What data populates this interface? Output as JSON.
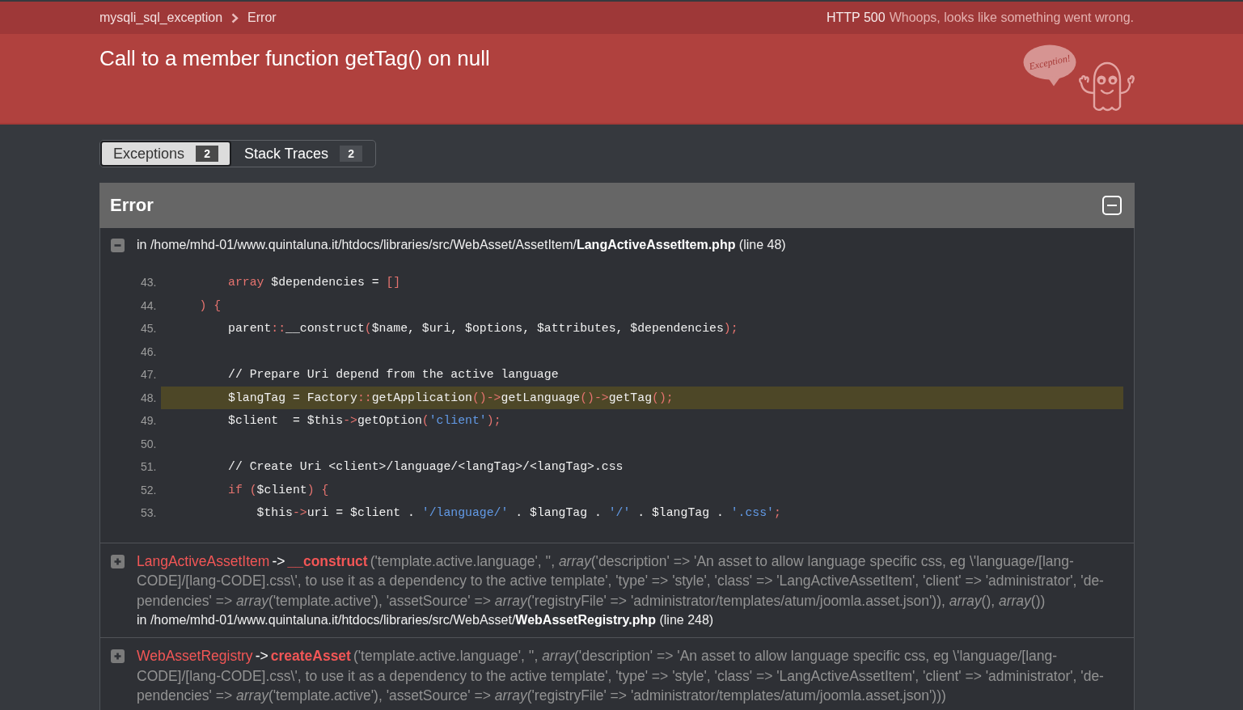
{
  "breadcrumb": {
    "items": [
      "mysqli_sql_exception",
      "Error"
    ],
    "status_code": "HTTP 500",
    "status_message": "Whoops, looks like something went wrong."
  },
  "header": {
    "title": "Call to a member function getTag() on null",
    "logo_text": "Exception!"
  },
  "tabs": [
    {
      "label": "Exceptions",
      "count": "2",
      "selected": true
    },
    {
      "label": "Stack Traces",
      "count": "2",
      "selected": false
    }
  ],
  "exception": {
    "title": "Error",
    "expanded": true,
    "frames": [
      {
        "kind": "source",
        "expanded": true,
        "location": "in /home/mhd-01/www.quintaluna.it/htdocs/libraries/src/WebAsset/AssetItem/**LangActiveAssetItem.php** (line 48)",
        "code": [
          {
            "number": "43.",
            "highlighted": false,
            "tokens": [
              {
                "kind": "keyword",
                "text": "        array"
              },
              {
                "kind": "plain",
                "text": " $dependencies = "
              },
              {
                "kind": "operator",
                "text": "[]"
              }
            ]
          },
          {
            "number": "44.",
            "highlighted": false,
            "tokens": [
              {
                "kind": "operator",
                "text": "    ) {"
              }
            ]
          },
          {
            "number": "45.",
            "highlighted": false,
            "tokens": [
              {
                "kind": "plain",
                "text": "        parent"
              },
              {
                "kind": "operator",
                "text": "::"
              },
              {
                "kind": "plain",
                "text": "__construct"
              },
              {
                "kind": "operator",
                "text": "("
              },
              {
                "kind": "plain",
                "text": "$name, $uri, $options, $attributes, $dependencies"
              },
              {
                "kind": "operator",
                "text": ");"
              }
            ]
          },
          {
            "number": "46.",
            "highlighted": false
          },
          {
            "number": "47.",
            "highlighted": false,
            "tokens": [
              {
                "kind": "comment",
                "text": "        // Prepare Uri depend from the active language"
              }
            ]
          },
          {
            "number": "48.",
            "highlighted": true,
            "tokens": [
              {
                "kind": "plain",
                "text": "        $langTag = Factory"
              },
              {
                "kind": "operator",
                "text": "::"
              },
              {
                "kind": "plain",
                "text": "getApplication"
              },
              {
                "kind": "operator",
                "text": "()->"
              },
              {
                "kind": "plain",
                "text": "getLanguage"
              },
              {
                "kind": "operator",
                "text": "()->"
              },
              {
                "kind": "plain",
                "text": "getTag"
              },
              {
                "kind": "operator",
                "text": "();"
              }
            ]
          },
          {
            "number": "49.",
            "highlighted": false,
            "tokens": [
              {
                "kind": "plain",
                "text": "        $client  = $this"
              },
              {
                "kind": "operator",
                "text": "->"
              },
              {
                "kind": "plain",
                "text": "getOption"
              },
              {
                "kind": "operator",
                "text": "("
              },
              {
                "kind": "string",
                "text": "'client'"
              },
              {
                "kind": "operator",
                "text": ");"
              }
            ]
          },
          {
            "number": "50.",
            "highlighted": false
          },
          {
            "number": "51.",
            "highlighted": false,
            "tokens": [
              {
                "kind": "comment",
                "text": "        // Create Uri <client>/language/<langTag>/<langTag>.css"
              }
            ]
          },
          {
            "number": "52.",
            "highlighted": false,
            "tokens": [
              {
                "kind": "keyword",
                "text": "        if"
              },
              {
                "kind": "operator",
                "text": " ("
              },
              {
                "kind": "plain",
                "text": "$client"
              },
              {
                "kind": "operator",
                "text": ") {"
              }
            ]
          },
          {
            "number": "53.",
            "highlighted": false,
            "tokens": [
              {
                "kind": "plain",
                "text": "            $this"
              },
              {
                "kind": "operator",
                "text": "->"
              },
              {
                "kind": "plain",
                "text": "uri = $client . "
              },
              {
                "kind": "string",
                "text": "'/language/'"
              },
              {
                "kind": "plain",
                "text": " . $langTag . "
              },
              {
                "kind": "string",
                "text": "'/'"
              },
              {
                "kind": "plain",
                "text": " . $langTag . "
              },
              {
                "kind": "string",
                "text": "'.css'"
              },
              {
                "kind": "operator",
                "text": ";"
              }
            ]
          }
        ]
      },
      {
        "kind": "call",
        "expanded": false,
        "class": "LangActiveAssetItem",
        "call_type": "->",
        "function": "__construct",
        "args": "('template.active.language', '', *array*('description' => 'An asset to allow language specific css, eg \\'language/[lang-CODE]/[lang-CODE].css\\', to use it as a dependency to the active template', 'type' => 'style', 'class' => 'LangActiveAssetItem', 'client' => 'administrator', 'de-pendencies' => *array*('template.active'), 'assetSource' => *array*('registryFile' => 'administrator/templates/atum/joomla.asset.json')), *array*(), *array*())",
        "location": "in /home/mhd-01/www.quintaluna.it/htdocs/libraries/src/WebAsset/**WebAssetRegistry.php** (line 248)"
      },
      {
        "kind": "call",
        "expanded": false,
        "class": "WebAssetRegistry",
        "call_type": "->",
        "function": "createAsset",
        "args": "('template.active.language', '', *array*('description' => 'An asset to allow language specific css, eg \\'language/[lang-CODE]/[lang-CODE].css\\', to use it as a dependency to the active template', 'type' => 'style', 'class' => 'LangActiveAssetItem', 'client' => 'administrator', 'de-pendencies' => *array*('template.active'), 'assetSource' => *array*('registryFile' => 'administrator/templates/atum/joomla.asset.json')))"
      }
    ]
  }
}
